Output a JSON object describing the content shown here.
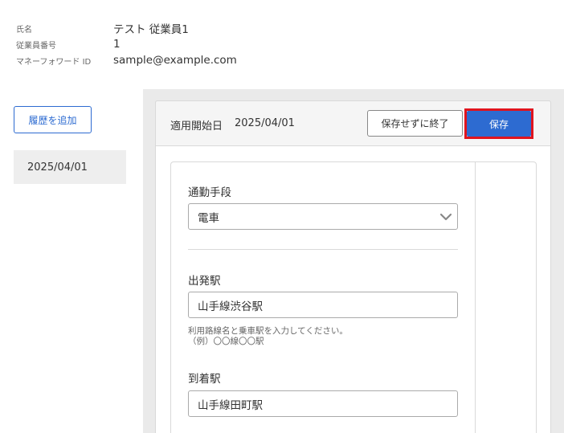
{
  "employee": {
    "name_label": "氏名",
    "name_value": "テスト 従業員1",
    "number_label": "従業員番号",
    "number_value": "1",
    "mf_id_label": "マネーフォワード ID",
    "mf_id_value": "sample@example.com"
  },
  "history": {
    "add_button": "履歴を追加",
    "items": [
      {
        "label": "2025/04/01"
      }
    ]
  },
  "card": {
    "start_label": "適用開始日",
    "start_value": "2025/04/01",
    "exit_button": "保存せずに終了",
    "save_button": "保存"
  },
  "form": {
    "commute_method_label": "通勤手段",
    "commute_method_value": "電車",
    "departure_label": "出発駅",
    "departure_value": "山手線渋谷駅",
    "help_line1": "利用路線名と乗車駅を入力してください。",
    "help_line2": "（例）〇〇線〇〇駅",
    "arrival_label": "到着駅",
    "arrival_value": "山手線田町駅"
  },
  "colors": {
    "accent": "#2d6bd1",
    "highlight": "#e0141e"
  }
}
